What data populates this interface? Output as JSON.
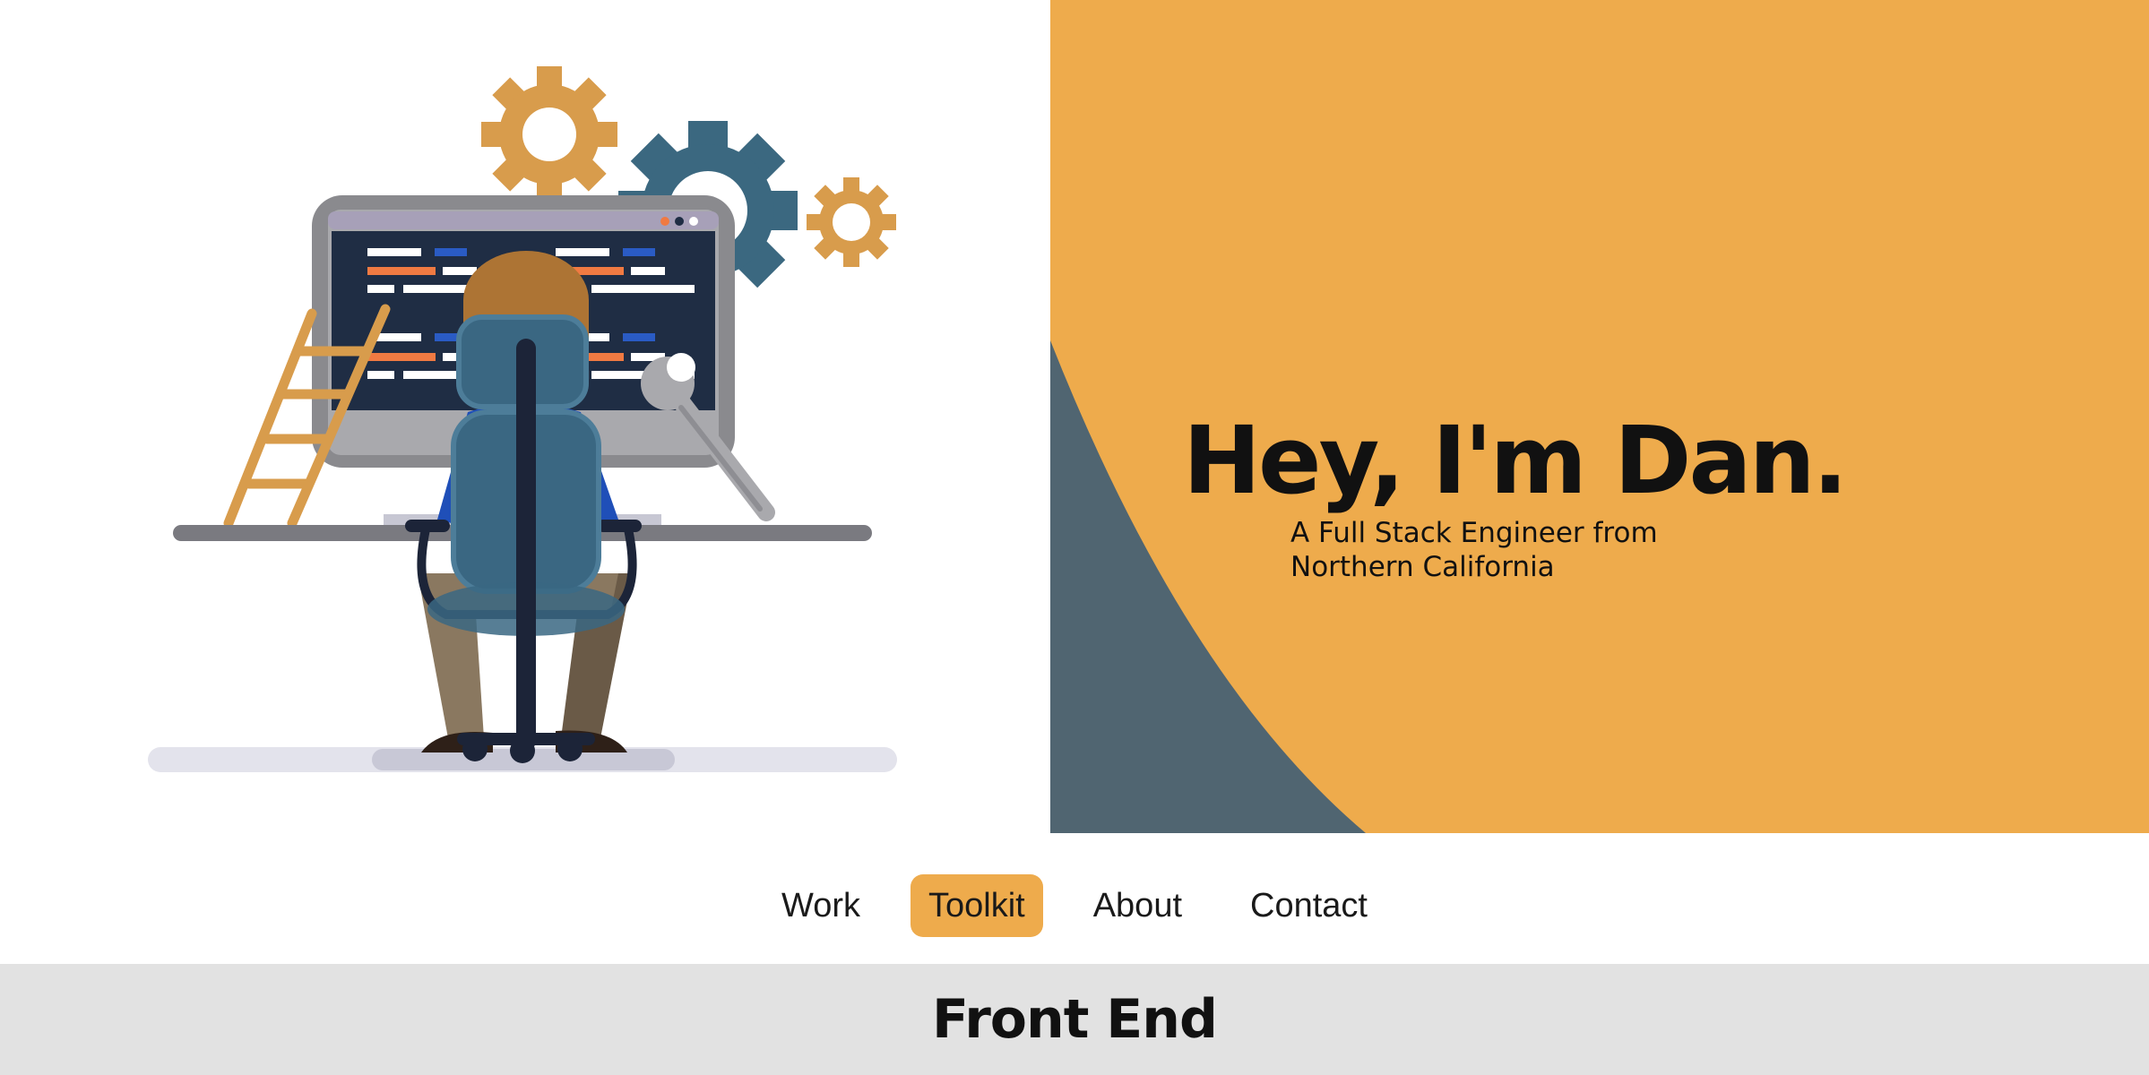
{
  "hero": {
    "greeting": "Hey, I'm Dan.",
    "tagline": "A Full Stack Engineer from Northern California"
  },
  "nav": {
    "items": [
      {
        "label": "Work",
        "active": false
      },
      {
        "label": "Toolkit",
        "active": true
      },
      {
        "label": "About",
        "active": false
      },
      {
        "label": "Contact",
        "active": false
      }
    ]
  },
  "section": {
    "title": "Front End"
  },
  "colors": {
    "accent": "#eeab4c",
    "slate": "#506571",
    "section_bg": "#e2e2e2",
    "screen": "#1f2d44",
    "gear_gold": "#d89c4c",
    "gear_blue": "#3b6880"
  },
  "icons": [
    "developer-illustration",
    "gear-icon",
    "wrench-icon",
    "ladder-icon",
    "monitor-icon"
  ]
}
